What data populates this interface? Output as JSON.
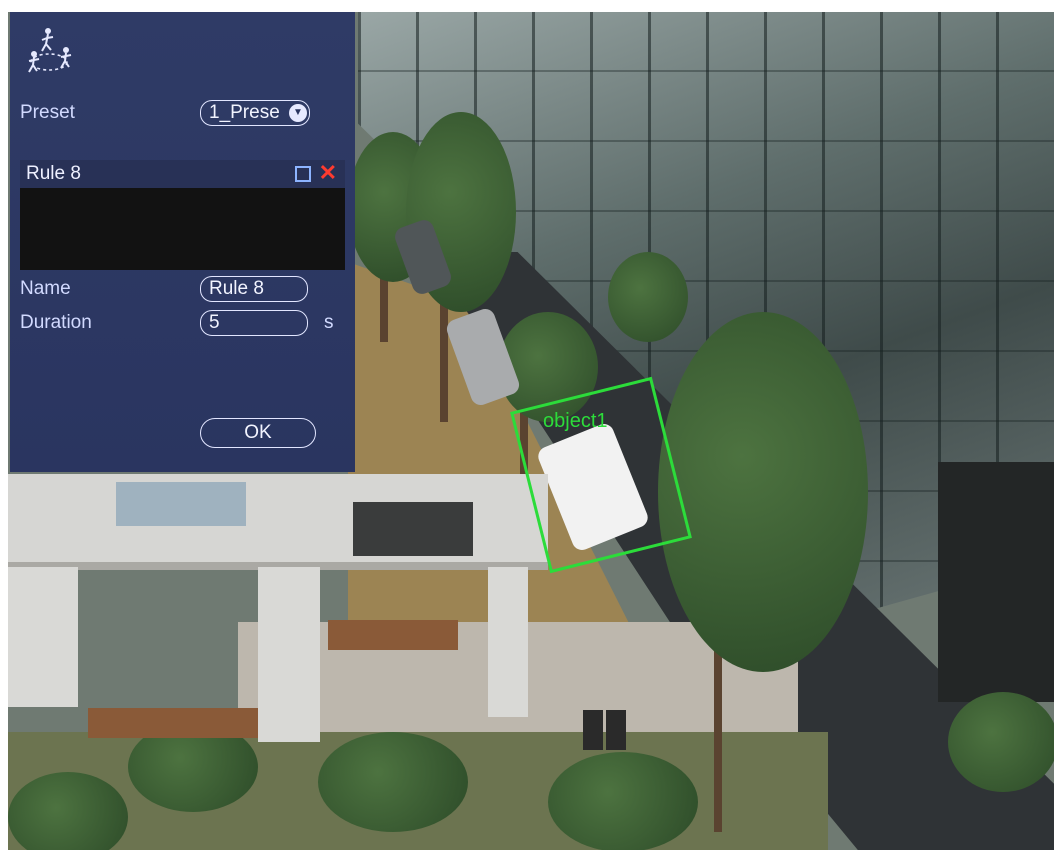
{
  "panel": {
    "icon": "tripwire-people-icon",
    "preset_label": "Preset",
    "preset_value": "1_Prese",
    "rules": [
      {
        "label": "Rule 8"
      }
    ],
    "name_label": "Name",
    "name_value": "Rule 8",
    "duration_label": "Duration",
    "duration_value": "5",
    "duration_unit": "s",
    "ok_label": "OK"
  },
  "scene": {
    "detection_label": "object1",
    "detection_color": "#2cdc3a"
  }
}
